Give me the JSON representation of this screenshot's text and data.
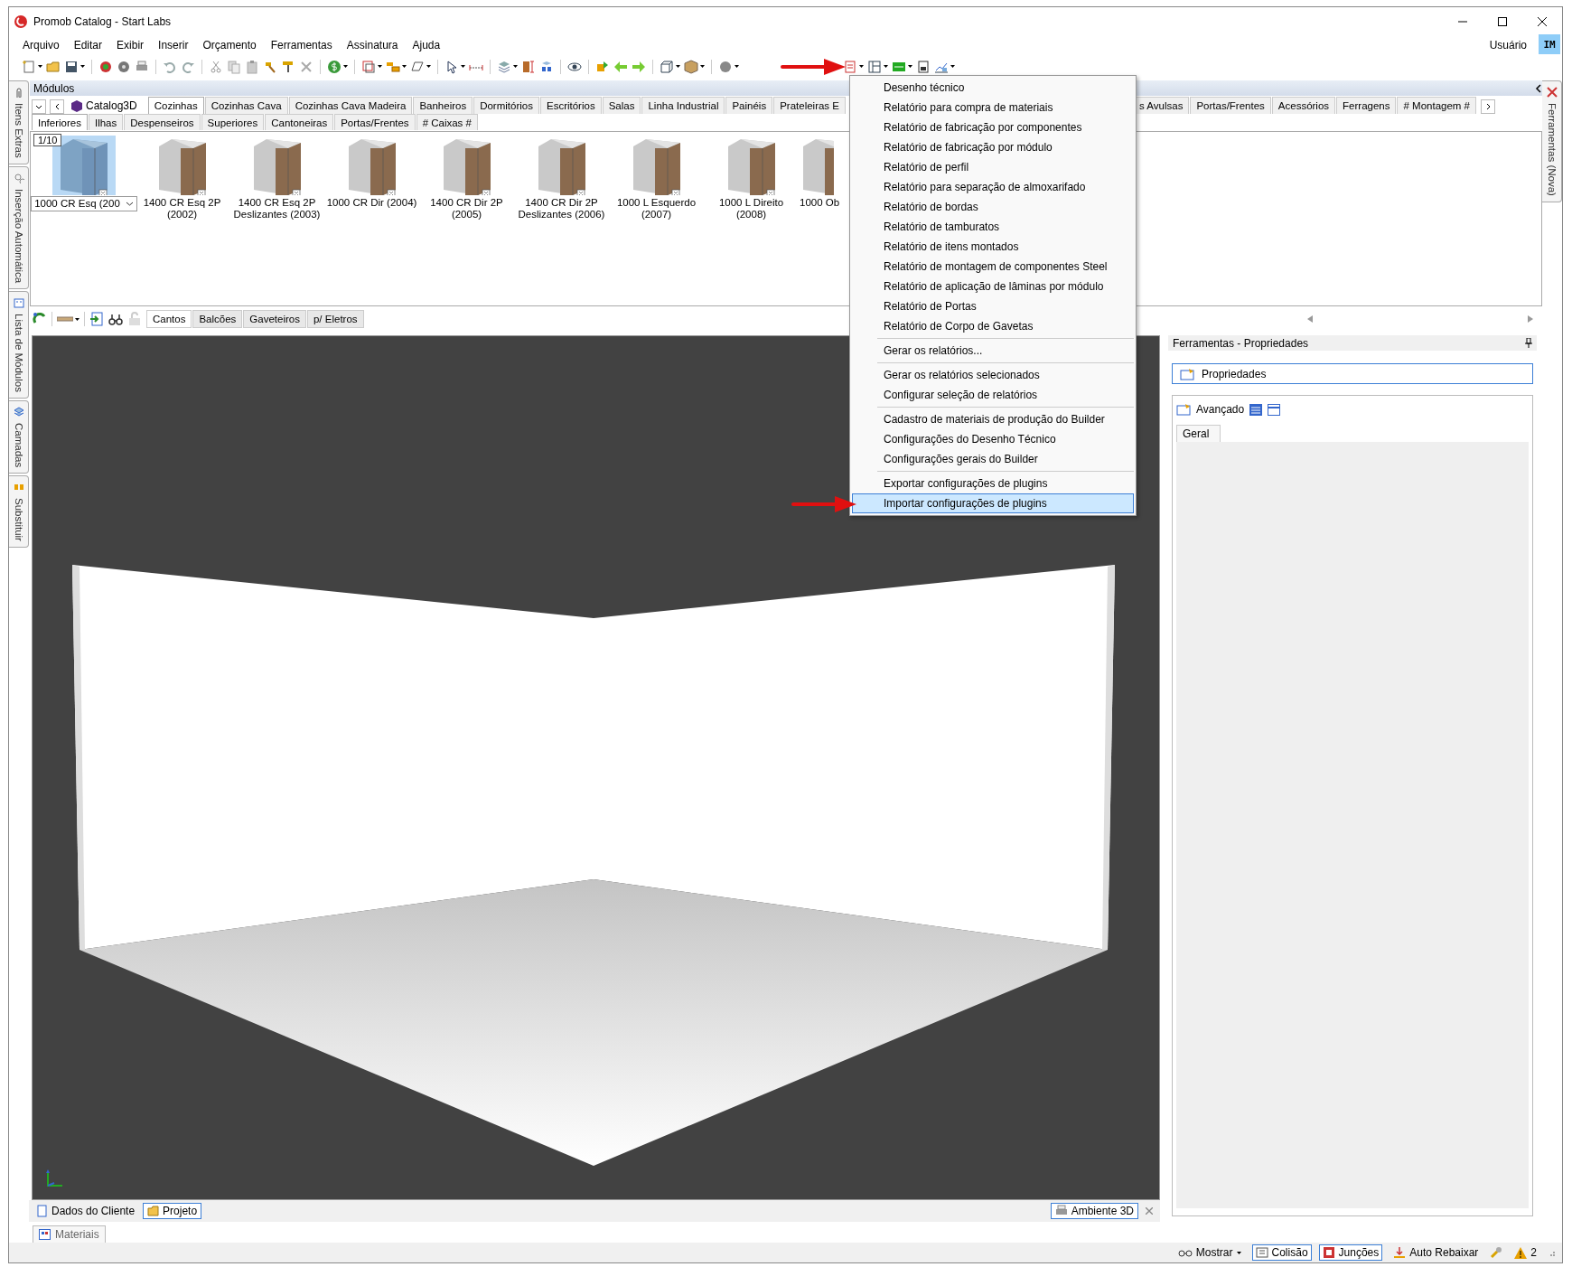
{
  "window": {
    "title": "Promob Catalog - Start Labs"
  },
  "menu_bar": [
    "Arquivo",
    "Editar",
    "Exibir",
    "Inserir",
    "Orçamento",
    "Ferramentas",
    "Assinatura",
    "Ajuda"
  ],
  "user": {
    "label": "Usuário",
    "initials": "IM"
  },
  "left_dock_tabs": [
    "Itens Extras",
    "Inserção Automática",
    "Lista de Módulos",
    "Camadas",
    "Substituir"
  ],
  "right_dock_tabs": [
    "Ferramentas (Nova)"
  ],
  "modules": {
    "title": "Módulos",
    "catalog": "Catalog3D",
    "category_tabs": [
      {
        "label": "Cozinhas",
        "selected": true
      },
      {
        "label": "Cozinhas Cava",
        "selected": false
      },
      {
        "label": "Cozinhas Cava Madeira",
        "selected": false
      },
      {
        "label": "Banheiros",
        "selected": false
      },
      {
        "label": "Dormitórios",
        "selected": false
      },
      {
        "label": "Escritórios",
        "selected": false
      },
      {
        "label": "Salas",
        "selected": false
      },
      {
        "label": "Linha Industrial",
        "selected": false
      },
      {
        "label": "Painéis",
        "selected": false
      },
      {
        "label": "Prateleiras E",
        "selected": false
      }
    ],
    "category_tabs_right": [
      {
        "label": "s Avulsas",
        "selected": false
      },
      {
        "label": "Portas/Frentes",
        "selected": false
      },
      {
        "label": "Acessórios",
        "selected": false
      },
      {
        "label": "Ferragens",
        "selected": false
      },
      {
        "label": "# Montagem #",
        "selected": false
      }
    ],
    "sub_tabs": [
      {
        "label": "Inferiores",
        "selected": true
      },
      {
        "label": "Ilhas",
        "selected": false
      },
      {
        "label": "Despenseiros",
        "selected": false
      },
      {
        "label": "Superiores",
        "selected": false
      },
      {
        "label": "Cantoneiras",
        "selected": false
      },
      {
        "label": "Portas/Frentes",
        "selected": false
      },
      {
        "label": "# Caixas #",
        "selected": false
      }
    ],
    "page": "1/10",
    "items": [
      {
        "name": "1000 CR Esq (200",
        "selected": true
      },
      {
        "name": "1400 CR Esq 2P (2002)",
        "selected": false
      },
      {
        "name": "1400 CR Esq 2P Deslizantes (2003)",
        "selected": false
      },
      {
        "name": "1000 CR Dir (2004)",
        "selected": false
      },
      {
        "name": "1400 CR Dir 2P (2005)",
        "selected": false
      },
      {
        "name": "1400 CR Dir 2P Deslizantes (2006)",
        "selected": false
      },
      {
        "name": "1000 L Esquerdo (2007)",
        "selected": false
      },
      {
        "name": "1000 L Direito (2008)",
        "selected": false
      },
      {
        "name": "1000 Ob",
        "selected": false
      }
    ]
  },
  "filter_tabs": [
    {
      "label": "Cantos",
      "selected": true
    },
    {
      "label": "Balcões",
      "selected": false
    },
    {
      "label": "Gaveteiros",
      "selected": false
    },
    {
      "label": "p/ Eletros",
      "selected": false
    }
  ],
  "viewport": {
    "tabs": [
      {
        "label": "Dados do Cliente",
        "selected": false
      },
      {
        "label": "Projeto",
        "selected": true
      }
    ],
    "view_tab": "Ambiente 3D"
  },
  "bottom_tabs": [
    "Materiais"
  ],
  "properties": {
    "title": "Ferramentas - Propriedades",
    "button": "Propriedades",
    "group": "Avançado",
    "tabs": [
      {
        "label": "Geral",
        "selected": true
      }
    ]
  },
  "status_bar": [
    {
      "kind": "dropdown",
      "label": "Mostrar"
    },
    {
      "kind": "toggle",
      "label": "Colisão",
      "on": true
    },
    {
      "kind": "toggle",
      "label": "Junções",
      "on": true
    },
    {
      "kind": "toggle",
      "label": "Auto Rebaixar",
      "on": false
    },
    {
      "kind": "tool"
    },
    {
      "kind": "warning",
      "label": "2"
    }
  ],
  "report_menu": [
    {
      "kind": "item",
      "label": "Desenho técnico",
      "selected": false
    },
    {
      "kind": "item",
      "label": "Relatório para compra de materiais",
      "selected": false
    },
    {
      "kind": "item",
      "label": "Relatório de fabricação por componentes",
      "selected": false
    },
    {
      "kind": "item",
      "label": "Relatório de fabricação por módulo",
      "selected": false
    },
    {
      "kind": "item",
      "label": "Relatório de perfil",
      "selected": false
    },
    {
      "kind": "item",
      "label": "Relatório para separação de almoxarifado",
      "selected": false
    },
    {
      "kind": "item",
      "label": "Relatório de bordas",
      "selected": false
    },
    {
      "kind": "item",
      "label": "Relatório de tamburatos",
      "selected": false
    },
    {
      "kind": "item",
      "label": "Relatório de itens montados",
      "selected": false
    },
    {
      "kind": "item",
      "label": "Relatório de montagem de componentes Steel",
      "selected": false
    },
    {
      "kind": "item",
      "label": "Relatório de aplicação de lâminas por módulo",
      "selected": false
    },
    {
      "kind": "item",
      "label": "Relatório de Portas",
      "selected": false
    },
    {
      "kind": "item",
      "label": "Relatório de Corpo de Gavetas",
      "selected": false
    },
    {
      "kind": "separator"
    },
    {
      "kind": "item",
      "label": "Gerar os relatórios...",
      "selected": false
    },
    {
      "kind": "separator"
    },
    {
      "kind": "item",
      "label": "Gerar os relatórios selecionados",
      "selected": false
    },
    {
      "kind": "item",
      "label": "Configurar seleção de relatórios",
      "selected": false
    },
    {
      "kind": "separator"
    },
    {
      "kind": "item",
      "label": "Cadastro de materiais de produção do Builder",
      "selected": false
    },
    {
      "kind": "item",
      "label": "Configurações do Desenho Técnico",
      "selected": false
    },
    {
      "kind": "item",
      "label": "Configurações gerais do Builder",
      "selected": false
    },
    {
      "kind": "separator"
    },
    {
      "kind": "item",
      "label": "Exportar configurações de plugins",
      "selected": false
    },
    {
      "kind": "item",
      "label": "Importar configurações de plugins",
      "selected": true
    }
  ]
}
